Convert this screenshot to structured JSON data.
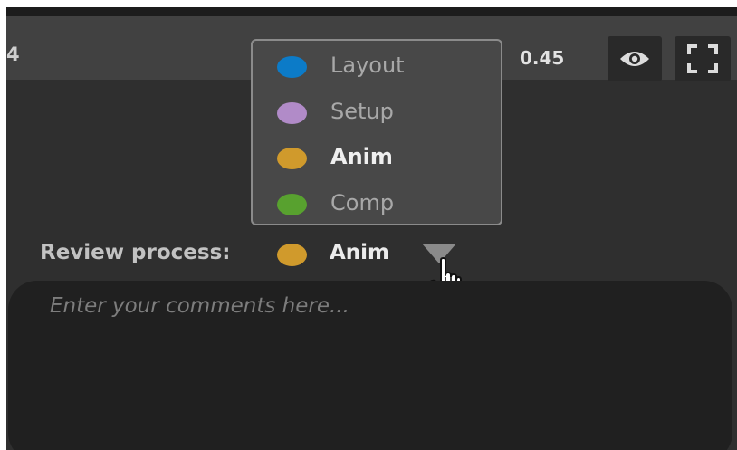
{
  "toolbar": {
    "frame_number": "4",
    "opacity_value": "0.45",
    "eye_icon": "eye-icon",
    "fullscreen_icon": "fullscreen-icon"
  },
  "review_dropdown": {
    "options": [
      {
        "label": "Layout",
        "color": "#0c7bc8"
      },
      {
        "label": "Setup",
        "color": "#b18bc8"
      },
      {
        "label": "Anim",
        "color": "#d09a2c",
        "selected": true
      },
      {
        "label": "Comp",
        "color": "#58a12f"
      }
    ]
  },
  "review": {
    "label": "Review process:",
    "value": "Anim",
    "value_color": "#d09a2c"
  },
  "comment": {
    "placeholder": "Enter your comments here...",
    "value": ""
  }
}
